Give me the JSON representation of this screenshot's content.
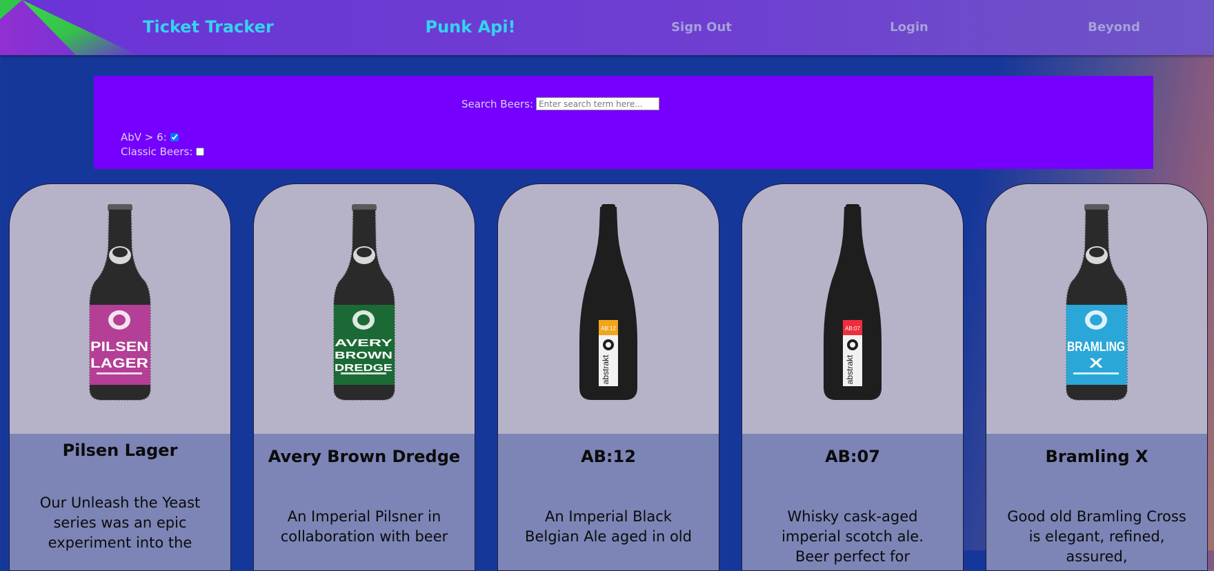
{
  "nav": {
    "ticket_tracker": "Ticket Tracker",
    "punk_api": "Punk Api!",
    "sign_out": "Sign Out",
    "login": "Login",
    "beyond": "Beyond"
  },
  "search": {
    "label": "Search Beers:",
    "placeholder": "Enter search term here...",
    "value": ""
  },
  "filters": {
    "abv_label": "AbV > 6:",
    "abv_checked": true,
    "classic_label": "Classic Beers:",
    "classic_checked": false
  },
  "beers": [
    {
      "name": "Pilsen Lager",
      "description": "Our Unleash the Yeast series was an epic experiment into the",
      "label_color": "#b43f96",
      "bottle": "stubby",
      "label_text": [
        "PILSEN",
        "LAGER"
      ]
    },
    {
      "name": "Avery Brown Dredge",
      "description": "An Imperial Pilsner in collaboration with beer",
      "label_color": "#1b6a35",
      "bottle": "stubby",
      "label_text": [
        "AVERY",
        "BROWN",
        "DREDGE"
      ]
    },
    {
      "name": "AB:12",
      "description": "An Imperial Black Belgian Ale aged in old",
      "label_color": "#f0a61d",
      "bottle": "abstrakt",
      "label_text": [
        "AB:12",
        "abstrakt"
      ]
    },
    {
      "name": "AB:07",
      "description": "Whisky cask-aged imperial scotch ale. Beer perfect for",
      "label_color": "#ee2d3d",
      "bottle": "abstrakt",
      "label_text": [
        "AB:07",
        "abstrakt"
      ]
    },
    {
      "name": "Bramling X",
      "description": "Good old Bramling Cross is elegant, refined, assured,",
      "label_color": "#2aa7d8",
      "bottle": "stubby",
      "label_text": [
        "BRAMLING",
        "X"
      ]
    }
  ],
  "colors": {
    "nav_bar": "#6b33d6",
    "nav_accent": "#33d4ee",
    "nav_muted": "#a6a2d9",
    "page_bg": "#16379a",
    "search_panel": "#7600fe",
    "card_image_bg": "#b6b3c9",
    "card_body_bg": "#7c85b6"
  }
}
